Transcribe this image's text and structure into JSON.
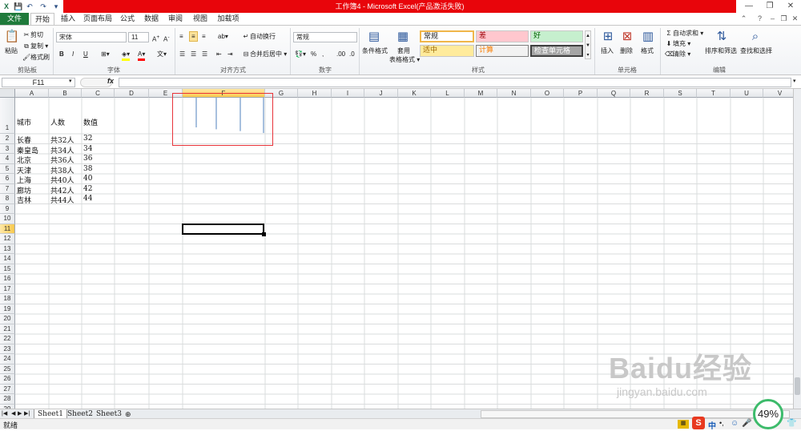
{
  "window": {
    "title": "工作簿4 - Microsoft Excel(产品激活失败)"
  },
  "qat": {
    "save": "💾",
    "undo": "↶",
    "redo": "↷",
    "more": "▾"
  },
  "tabs": [
    {
      "label": "文件",
      "key": "file"
    },
    {
      "label": "开始",
      "key": "home"
    },
    {
      "label": "插入",
      "key": "insert"
    },
    {
      "label": "页面布局",
      "key": "layout"
    },
    {
      "label": "公式",
      "key": "formulas"
    },
    {
      "label": "数据",
      "key": "data"
    },
    {
      "label": "审阅",
      "key": "review"
    },
    {
      "label": "视图",
      "key": "view"
    },
    {
      "label": "加载项",
      "key": "addins"
    }
  ],
  "ribbon": {
    "clipboard": {
      "paste": "粘贴",
      "cut": "剪切",
      "copy": "复制 ▾",
      "format_painter": "格式刷",
      "label": "剪贴板"
    },
    "font": {
      "name": "宋体",
      "size": "11",
      "label": "字体",
      "bold": "B",
      "italic": "I",
      "underline": "U"
    },
    "alignment": {
      "wrap": "自动换行",
      "merge": "合并后居中 ▾",
      "label": "对齐方式"
    },
    "number": {
      "format": "常规",
      "label": "数字"
    },
    "styles": {
      "conditional": "条件格式",
      "table": "套用",
      "table2": "表格格式 ▾",
      "cells": [
        {
          "text": "常规"
        },
        {
          "text": "差"
        },
        {
          "text": "好"
        },
        {
          "text": "适中"
        },
        {
          "text": "计算"
        },
        {
          "text": "检查单元格"
        }
      ],
      "label": "样式"
    },
    "cells": {
      "insert": "插入",
      "delete": "删除",
      "format": "格式",
      "label": "单元格"
    },
    "editing": {
      "autosum": "自动求和 ▾",
      "fill": "填充 ▾",
      "clear": "清除 ▾",
      "sort": "排序和筛选",
      "find": "查找和选择",
      "label": "编辑"
    }
  },
  "formula_bar": {
    "name_box": "F11",
    "fx": "fx",
    "value": ""
  },
  "columns": [
    "A",
    "B",
    "C",
    "D",
    "E",
    "F",
    "G",
    "H",
    "I",
    "J",
    "K",
    "L",
    "M",
    "N",
    "O",
    "P",
    "Q",
    "R",
    "S",
    "T",
    "U",
    "V"
  ],
  "rows": [
    "1",
    "2",
    "3",
    "4",
    "5",
    "6",
    "7",
    "8",
    "9",
    "10",
    "11",
    "12",
    "13",
    "14",
    "15",
    "16",
    "17",
    "18",
    "19",
    "20",
    "21",
    "22",
    "23",
    "24",
    "25",
    "26",
    "27",
    "28",
    "29"
  ],
  "cells": {
    "header": [
      "城市",
      "人数",
      "数值"
    ],
    "data": [
      [
        "长春",
        "共32人",
        "32"
      ],
      [
        "秦皇岛",
        "共34人",
        "34"
      ],
      [
        "北京",
        "共36人",
        "36"
      ],
      [
        "天津",
        "共38人",
        "38"
      ],
      [
        "上海",
        "共40人",
        "40"
      ],
      [
        "廊坊",
        "共42人",
        "42"
      ],
      [
        "吉林",
        "共44人",
        "44"
      ]
    ]
  },
  "sparkline": {
    "values": [
      32,
      34,
      36,
      38
    ],
    "highlight_color": "#e8343a",
    "line_color": "#4f81bd"
  },
  "sheets": [
    "Sheet1",
    "Sheet2",
    "Sheet3"
  ],
  "status": {
    "ready": "就绪",
    "zoom": "49%"
  },
  "watermark": {
    "brand": "Baidu经验",
    "url": "jingyan.baidu.com"
  },
  "ime": {
    "lang": "中",
    "punct": "•,"
  }
}
